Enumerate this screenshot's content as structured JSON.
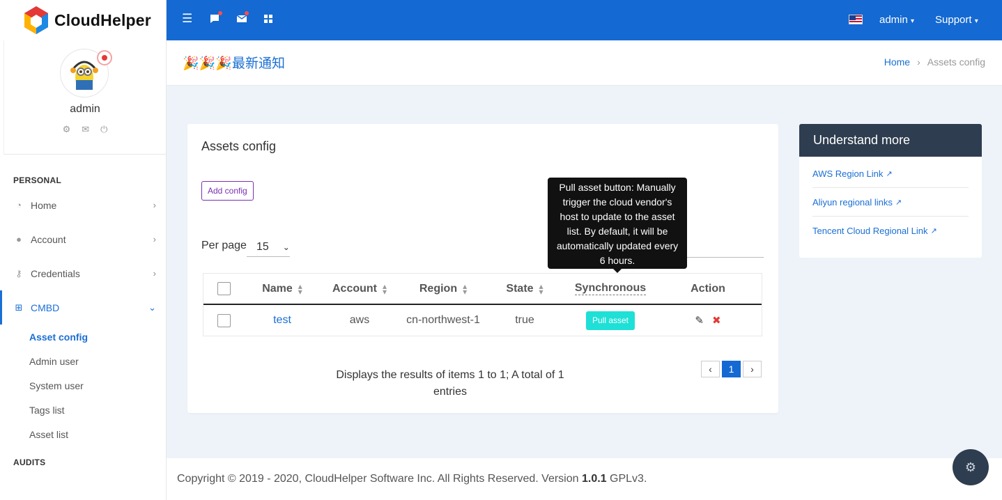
{
  "brand": {
    "name": "CloudHelper"
  },
  "profile": {
    "name": "admin"
  },
  "sidebar": {
    "section_personal": "PERSONAL",
    "items": [
      {
        "label": "Home",
        "icon": "dashboard-icon"
      },
      {
        "label": "Account",
        "icon": "user-icon"
      },
      {
        "label": "Credentials",
        "icon": "key-icon"
      },
      {
        "label": "CMBD",
        "icon": "sitemap-icon"
      }
    ],
    "sub_items": [
      "Asset config",
      "Admin user",
      "System user",
      "Tags list",
      "Asset list"
    ],
    "section_audits": "AUDITS"
  },
  "topbar": {
    "user_menu": "admin",
    "support_menu": "Support"
  },
  "header": {
    "notice": "🎉🎉🎉最新通知",
    "breadcrumb_home": "Home",
    "breadcrumb_current": "Assets config"
  },
  "card": {
    "title": "Assets config",
    "add_button": "Add config",
    "per_page_label": "Per page",
    "per_page_value": "15",
    "columns": [
      "Name",
      "Account",
      "Region",
      "State",
      "Synchronous",
      "Action"
    ],
    "rows": [
      {
        "name": "test",
        "account": "aws",
        "region": "cn-northwest-1",
        "state": "true",
        "sync_button": "Pull asset"
      }
    ],
    "tooltip": "Pull asset button: Manually trigger the cloud vendor's host to update to the asset list. By default, it will be automatically updated every 6 hours.",
    "result_text": "Displays the results of items 1 to 1; A total of 1 entries",
    "pager": {
      "prev": "‹",
      "current": "1",
      "next": "›"
    }
  },
  "side_panel": {
    "title": "Understand more",
    "links": [
      "AWS Region Link",
      "Aliyun regional links",
      "Tencent Cloud Regional Link"
    ]
  },
  "footer": {
    "copyright": "Copyright © 2019 - 2020, CloudHelper Software Inc. All Rights Reserved. Version",
    "version": "1.0.1",
    "license": "GPLv3."
  },
  "colors": {
    "primary": "#1469d2",
    "accent_purple": "#7a2fb0",
    "pull_button": "#1ee0d6",
    "panel_dark": "#2e3d4f"
  }
}
